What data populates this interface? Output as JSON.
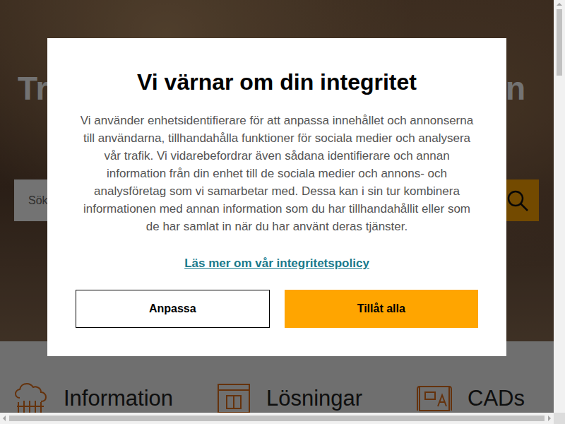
{
  "page": {
    "hero": {
      "heading_start": "Tr",
      "heading_end": "en",
      "search": {
        "placeholder": "Sök"
      }
    },
    "categories": [
      {
        "label": "Information"
      },
      {
        "label": "Lösningar"
      },
      {
        "label": "CADs"
      }
    ]
  },
  "consent": {
    "title": "Vi värnar om din integritet",
    "body": "Vi använder enhetsidentifierare för att anpassa innehållet och annonserna till användarna, tillhandahålla funktioner för sociala medier och analysera vår trafik. Vi vidarebefordrar även sådana identifierare och annan information från din enhet till de sociala medier och annons- och analysföretag som vi samarbetar med. Dessa kan i sin tur kombinera informationen med annan information som du har tillhandahållit eller som de har samlat in när du har använt deras tjänster.",
    "link": "Läs mer om vår integritetspolicy",
    "buttons": [
      {
        "label": "Anpassa",
        "kind": "outline"
      },
      {
        "label": "Tillåt alla",
        "kind": "primary"
      }
    ]
  }
}
